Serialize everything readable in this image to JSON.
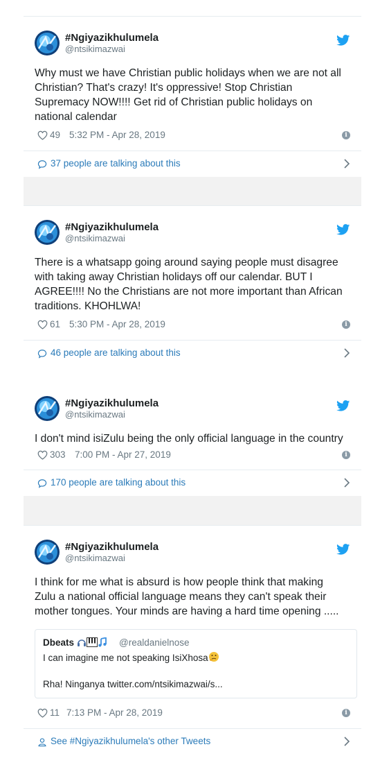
{
  "colors": {
    "accent_blue": "#2b7bb9",
    "twitter_blue": "#1da1f2",
    "gray_text": "#697882",
    "separator": "#f2f2f2"
  },
  "tweets": [
    {
      "name": "#Ngiyazikhulumela",
      "handle": "@ntsikimazwai",
      "lines": [
        "Why must we have Christian public holidays when we are not all",
        "Christian? That's crazy! It's oppressive! Stop Christian",
        "Supremacy NOW!!!! Get rid of Christian public holidays on",
        "national calendar"
      ],
      "likes": "49",
      "time": "5:32 PM - Apr 28, 2019",
      "talking": "37 people are talking about this"
    },
    {
      "name": "#Ngiyazikhulumela",
      "handle": "@ntsikimazwai",
      "lines": [
        "There is a whatsapp going around saying people must disagree",
        "with taking away Christian holidays off our calendar. BUT I",
        "AGREE!!!! No the Christians are not more important than African",
        "traditions. KHOHLWA!"
      ],
      "likes": "61",
      "time": "5:30 PM - Apr 28, 2019",
      "talking": "46 people are talking about this"
    },
    {
      "name": "#Ngiyazikhulumela",
      "handle": "@ntsikimazwai",
      "lines": [
        "I don't mind isiZulu being the only official language in the country"
      ],
      "likes": "303",
      "time": "7:00 PM - Apr 27, 2019",
      "talking": "170 people are talking about this"
    },
    {
      "name": "#Ngiyazikhulumela",
      "handle": "@ntsikimazwai",
      "lines": [
        "I think for me what is absurd is how people think that making",
        "Zulu a national official language means they can't speak their",
        "mother tongues. Your minds are having a hard time opening ....."
      ],
      "quote": {
        "name": "Dbeats",
        "handle": "@realdanielnose",
        "line1": "I can imagine me not speaking IsiXhosa",
        "line2": "Rha! Ninganya twitter.com/ntsikimazwai/s..."
      },
      "likes": "11",
      "time": "7:13 PM - Apr 28, 2019",
      "footer": "See #Ngiyazikhulumela's other Tweets"
    }
  ],
  "icons": [
    "avatar",
    "twitter-bird-icon",
    "heart-icon",
    "info-icon",
    "speech-bubble-icon",
    "chevron-right-icon",
    "person-icon",
    "headphones-emoji",
    "piano-emoji",
    "music-note-emoji",
    "thinking-face-emoji"
  ]
}
